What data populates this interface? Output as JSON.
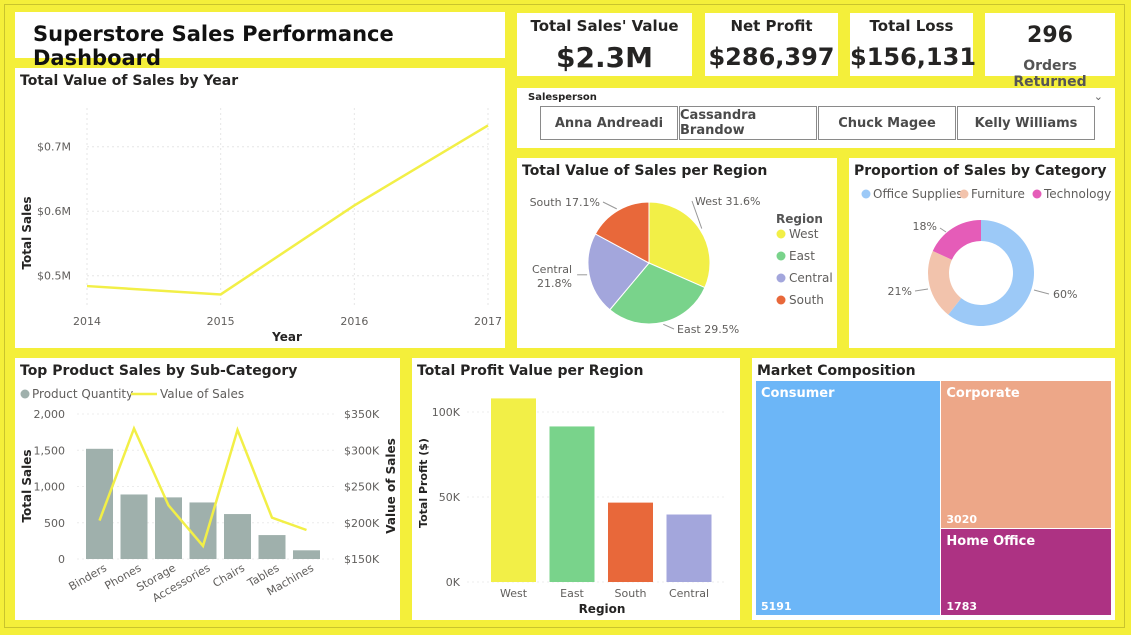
{
  "title": "Superstore Sales Performance Dashboard",
  "kpis": {
    "total_sales": {
      "label": "Total Sales' Value",
      "value": "$2.3M"
    },
    "net_profit": {
      "label": "Net Profit",
      "value": "$286,397"
    },
    "total_loss": {
      "label": "Total Loss",
      "value": "$156,131"
    },
    "orders_returned": {
      "label": "Orders Returned",
      "value": "296"
    }
  },
  "slicer": {
    "label": "Salesperson",
    "options": [
      "Anna Andreadi",
      "Cassandra Brandow",
      "Chuck Magee",
      "Kelly Williams"
    ]
  },
  "colors": {
    "background": "#f4ef3a",
    "yellow_line": "#f2ef47",
    "west": "#f2ef47",
    "east": "#79d38b",
    "central": "#a3a6dc",
    "south": "#e8683a",
    "office_supplies": "#9cc9f7",
    "furniture": "#f2c3ac",
    "technology": "#e55cb8",
    "quantity_bar": "#9fb0ac",
    "consumer": "#6cb6f7",
    "corporate": "#eda788",
    "home_office": "#ad3283"
  },
  "chart_data": [
    {
      "type": "line",
      "title": "Total Value of Sales by Year",
      "xlabel": "Year",
      "ylabel": "Total Sales",
      "x": [
        2014,
        2015,
        2016,
        2017
      ],
      "values": [
        0.484,
        0.471,
        0.609,
        0.733
      ],
      "yticks": [
        "$0.5M",
        "$0.6M",
        "$0.7M"
      ],
      "ytick_values": [
        0.5,
        0.6,
        0.7
      ],
      "ylim": [
        0.45,
        0.76
      ],
      "grid": true
    },
    {
      "type": "pie",
      "title": "Total Value of Sales per Region",
      "legend_title": "Region",
      "categories": [
        "West",
        "East",
        "Central",
        "South"
      ],
      "values": [
        31.6,
        29.5,
        21.8,
        17.1
      ],
      "labels": [
        "West 31.6%",
        "East 29.5%",
        "Central 21.8%",
        "South 17.1%"
      ]
    },
    {
      "type": "pie",
      "title": "Proportion of Sales by Category",
      "categories": [
        "Office Supplies",
        "Furniture",
        "Technology"
      ],
      "values": [
        60,
        21,
        18
      ],
      "labels": [
        "60%",
        "21%",
        "18%"
      ],
      "legend_position": "top"
    },
    {
      "type": "bar",
      "title": "Top Product Sales by Sub-Category",
      "categories": [
        "Binders",
        "Phones",
        "Storage",
        "Accessories",
        "Chairs",
        "Tables",
        "Machines"
      ],
      "series": [
        {
          "name": "Product Quantity",
          "type": "bar",
          "values": [
            1520,
            890,
            850,
            780,
            620,
            330,
            120
          ]
        },
        {
          "name": "Value of Sales",
          "type": "line",
          "values": [
            203000,
            330000,
            224000,
            168000,
            328000,
            207000,
            190000
          ]
        }
      ],
      "ylabel": "Total Sales",
      "y2label": "Value of Sales",
      "ylim": [
        0,
        2000
      ],
      "y2lim": [
        150000,
        350000
      ],
      "yticks": [
        "0",
        "500",
        "1,000",
        "1,500",
        "2,000"
      ],
      "y2ticks": [
        "$150K",
        "$200K",
        "$250K",
        "$300K",
        "$350K"
      ]
    },
    {
      "type": "bar",
      "title": "Total Profit Value per Region",
      "categories": [
        "West",
        "East",
        "Central",
        "South"
      ],
      "display_order": [
        "West",
        "East",
        "South",
        "Central"
      ],
      "values": [
        108000,
        91500,
        39700,
        46700
      ],
      "xlabel": "Region",
      "ylabel": "Total Profit ($)",
      "yticks": [
        "0K",
        "50K",
        "100K"
      ],
      "ylim": [
        0,
        120000
      ]
    },
    {
      "type": "treemap",
      "title": "Market Composition",
      "categories": [
        "Consumer",
        "Corporate",
        "Home Office"
      ],
      "values": [
        5191,
        3020,
        1783
      ]
    }
  ]
}
